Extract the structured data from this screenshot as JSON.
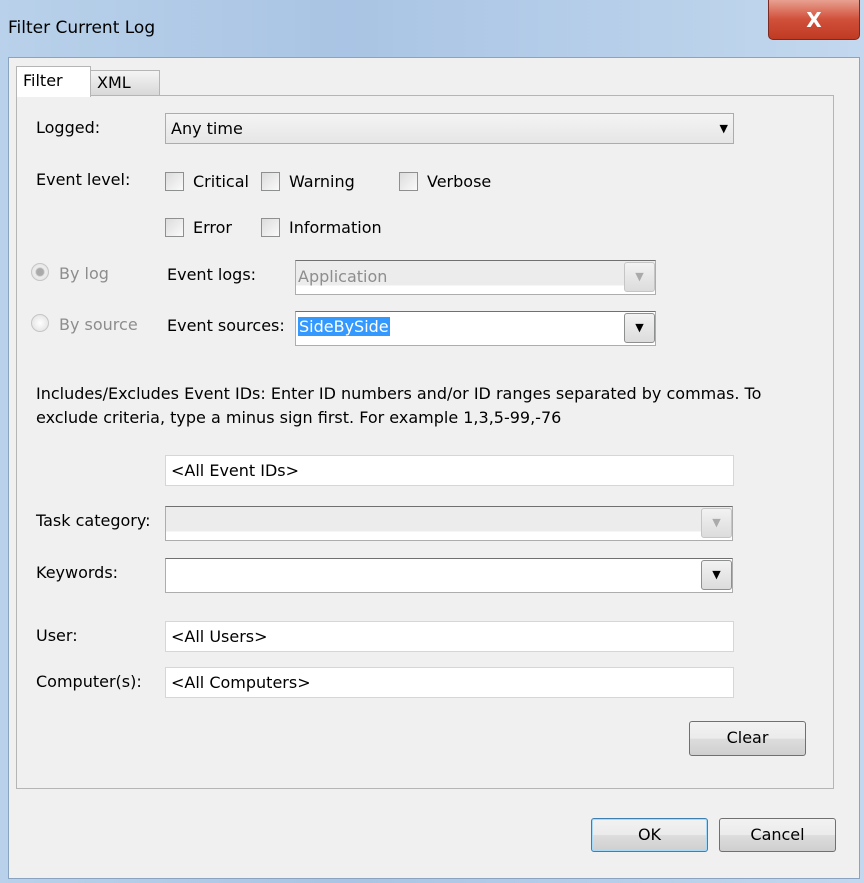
{
  "window": {
    "title": "Filter Current Log",
    "close_label": "X"
  },
  "tabs": [
    {
      "label": "Filter"
    },
    {
      "label": "XML"
    }
  ],
  "filter": {
    "logged_label": "Logged:",
    "logged_value": "Any time",
    "event_level_label": "Event level:",
    "levels": [
      {
        "label": "Critical",
        "checked": false
      },
      {
        "label": "Warning",
        "checked": false
      },
      {
        "label": "Verbose",
        "checked": false
      },
      {
        "label": "Error",
        "checked": false
      },
      {
        "label": "Information",
        "checked": false
      }
    ],
    "by_log_label": "By log",
    "by_source_label": "By source",
    "event_logs_label": "Event logs:",
    "event_logs_value": "Application",
    "event_sources_label": "Event sources:",
    "event_sources_value": "SideBySide",
    "ids_help": "Includes/Excludes Event IDs: Enter ID numbers and/or ID ranges separated by commas. To exclude criteria, type a minus sign first. For example 1,3,5-99,-76",
    "event_ids_value": "<All Event IDs>",
    "task_category_label": "Task category:",
    "task_category_value": "",
    "keywords_label": "Keywords:",
    "keywords_value": "",
    "user_label": "User:",
    "user_value": "<All Users>",
    "computers_label": "Computer(s):",
    "computers_value": "<All Computers>",
    "clear_label": "Clear"
  },
  "buttons": {
    "ok": "OK",
    "cancel": "Cancel"
  }
}
